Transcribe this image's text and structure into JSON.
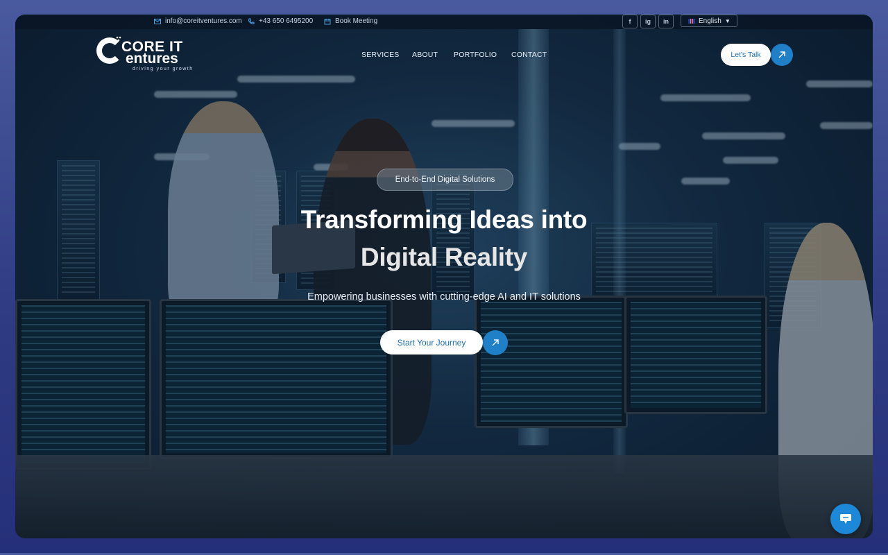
{
  "topbar": {
    "email": "info@coreitventures.com",
    "phone": "+43 650 6495200",
    "meeting": "Book Meeting",
    "social": [
      "f",
      "ig",
      "in"
    ],
    "language": "English"
  },
  "logo": {
    "line1": "CORE IT",
    "line2": "entures",
    "tagline": "driving your growth"
  },
  "nav": {
    "items": [
      "SERVICES",
      "ABOUT",
      "PORTFOLIO",
      "CONTACT"
    ],
    "cta": "Let's Talk"
  },
  "hero": {
    "badge": "End-to-End Digital Solutions",
    "title_line1": "Transforming Ideas into",
    "title_line2": "Digital Reality",
    "subtitle": "Empowering businesses with cutting-edge AI and IT solutions",
    "cta": "Start Your Journey"
  },
  "colors": {
    "accent": "#1f7fc7",
    "page_bg": "#2e3a82"
  },
  "icons": {
    "email": "email-icon",
    "phone": "phone-icon",
    "calendar": "calendar-icon",
    "arrow": "arrow-up-right-icon",
    "chat": "chat-icon"
  }
}
